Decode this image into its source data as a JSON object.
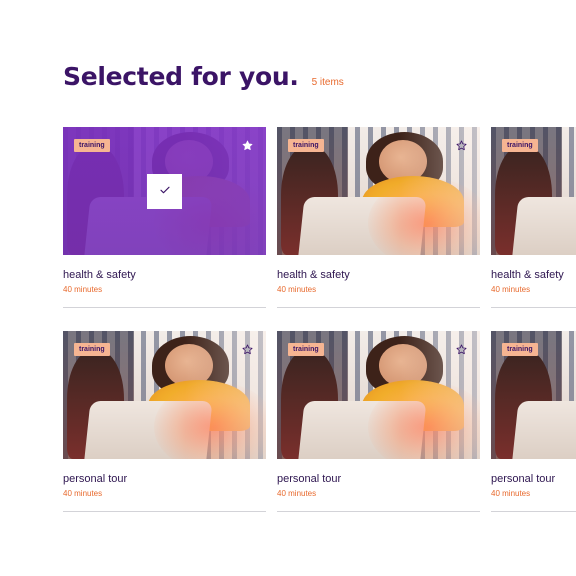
{
  "section": {
    "title": "Selected for you.",
    "count_label": "5 items"
  },
  "cards": [
    {
      "tag": "training",
      "title": "health & safety",
      "duration": "40 minutes",
      "selected": true,
      "favorite_icon": "star-icon"
    },
    {
      "tag": "training",
      "title": "health & safety",
      "duration": "40 minutes",
      "selected": false,
      "favorite_icon": "star-icon"
    },
    {
      "tag": "training",
      "title": "health & safety",
      "duration": "40 minutes",
      "selected": false,
      "favorite_icon": "star-icon"
    },
    {
      "tag": "training",
      "title": "personal tour",
      "duration": "40 minutes",
      "selected": false,
      "favorite_icon": "star-icon"
    },
    {
      "tag": "training",
      "title": "personal tour",
      "duration": "40 minutes",
      "selected": false,
      "favorite_icon": "star-icon"
    },
    {
      "tag": "training",
      "title": "personal tour",
      "duration": "40 minutes",
      "selected": false,
      "favorite_icon": "star-icon"
    }
  ],
  "colors": {
    "title": "#3b1466",
    "accent": "#e86a2e",
    "tag_bg": "#f6b592",
    "selected_overlay": "#7e30c4"
  }
}
